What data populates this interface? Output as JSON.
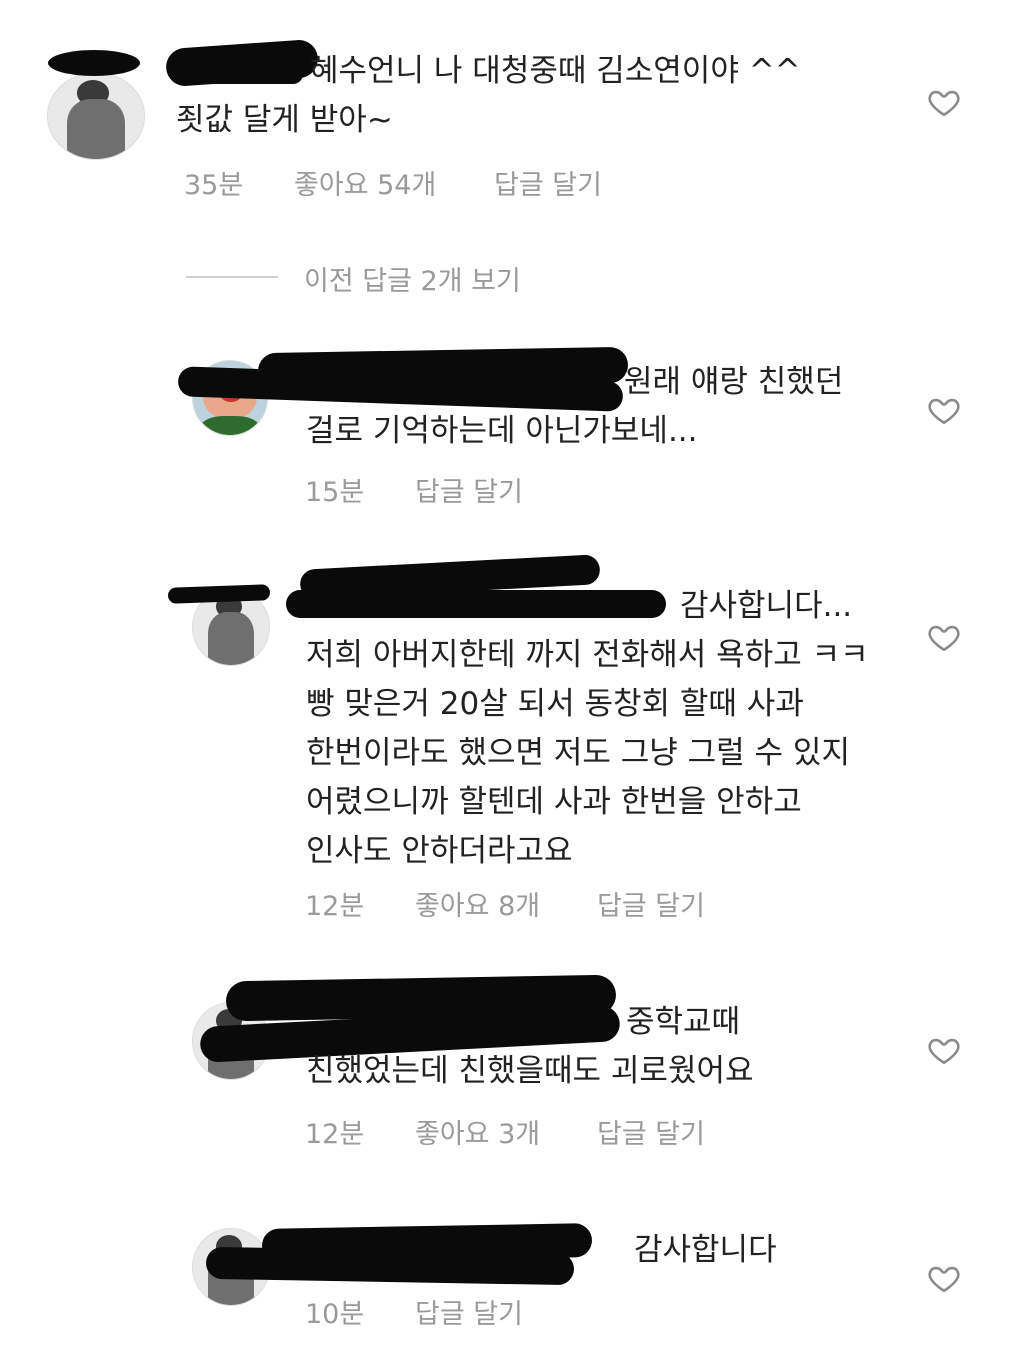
{
  "comments": [
    {
      "text": "혜수언니 나 대청중때 김소연이야 ^^\n죗값 달게 받아~",
      "time": "35분",
      "likes": "좋아요 54개",
      "reply": "답글 달기"
    },
    {
      "text": "원래 얘랑 친했던\n걸로 기억하는데 아닌가보네...",
      "time": "15분",
      "reply": "답글 달기"
    },
    {
      "text": "감사합니다...\n저희 아버지한테 까지 전화해서 욕하고 ㅋㅋ\n빵 맞은거 20살 되서 동창회 할때 사과\n한번이라도 했으면 저도 그냥 그럴 수 있지\n어렸으니까 할텐데 사과 한번을 안하고\n인사도 안하더라고요",
      "time": "12분",
      "likes": "좋아요 8개",
      "reply": "답글 달기"
    },
    {
      "text": "중학교때\n친했었는데 친했을때도 괴로웠어요",
      "time": "12분",
      "likes": "좋아요 3개",
      "reply": "답글 달기"
    },
    {
      "text": "감사합니다",
      "time": "10분",
      "reply": "답글 달기"
    }
  ],
  "view_previous": "이전 답글 2개 보기",
  "icons": {
    "like": "heart-outline-icon"
  },
  "colors": {
    "text": "#222222",
    "meta": "#9a9a9a",
    "redaction": "#0a0a0a"
  }
}
